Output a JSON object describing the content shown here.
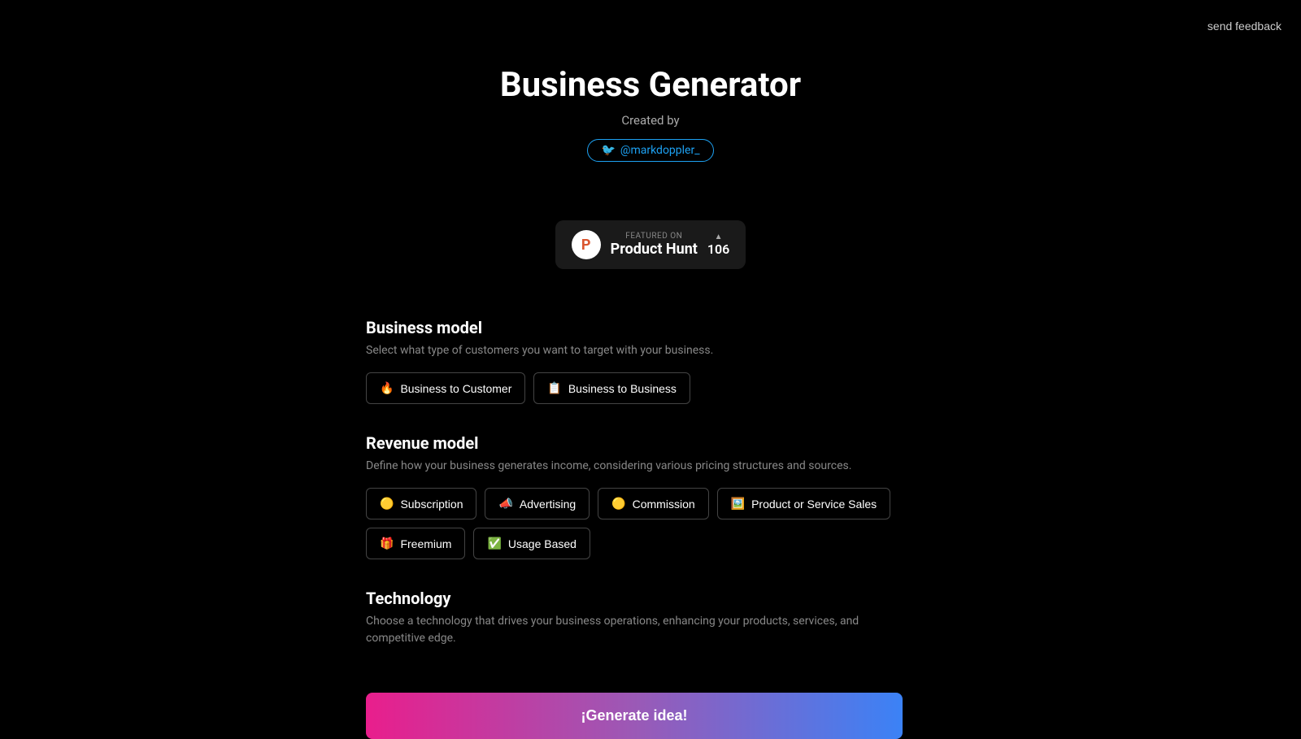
{
  "feedback": {
    "label": "send feedback"
  },
  "header": {
    "title": "Business Generator",
    "created_by": "Created by",
    "twitter_handle": "@markdoppler_",
    "product_hunt": {
      "logo_letter": "P",
      "featured_on": "FEATURED ON",
      "name": "Product Hunt",
      "votes": "106",
      "triangle": "▲"
    }
  },
  "business_model": {
    "title": "Business model",
    "description": "Select what type of customers you want to target with your business.",
    "options": [
      {
        "emoji": "🔥",
        "label": "Business to Customer"
      },
      {
        "emoji": "📋",
        "label": "Business to Business"
      }
    ]
  },
  "revenue_model": {
    "title": "Revenue model",
    "description": "Define how your business generates income, considering various pricing structures and sources.",
    "options_row1": [
      {
        "emoji": "🟡",
        "label": "Subscription"
      },
      {
        "emoji": "📣",
        "label": "Advertising"
      },
      {
        "emoji": "🟡",
        "label": "Commission"
      },
      {
        "emoji": "🖼️",
        "label": "Product or Service Sales"
      }
    ],
    "options_row2": [
      {
        "emoji": "🎁",
        "label": "Freemium"
      },
      {
        "emoji": "✅",
        "label": "Usage Based"
      }
    ]
  },
  "technology": {
    "title": "Technology",
    "description": "Choose a technology that drives your business operations, enhancing your products, services, and competitive edge."
  },
  "generate_button": {
    "label": "¡Generate idea!"
  }
}
